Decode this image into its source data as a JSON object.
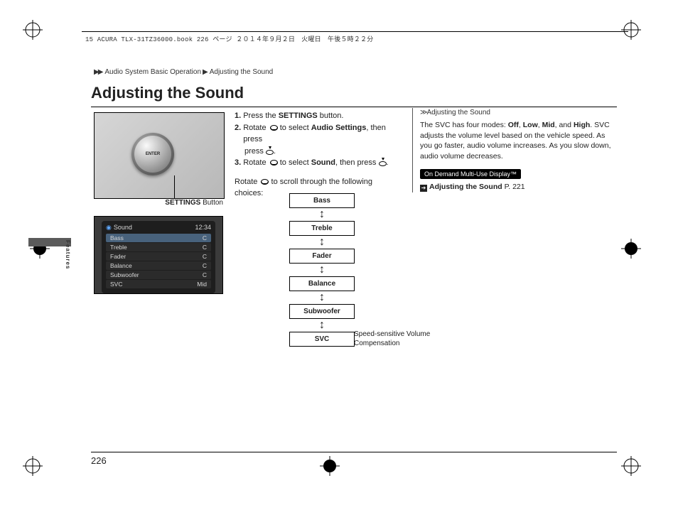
{
  "header_text": "15 ACURA TLX-31TZ36000.book  226 ページ  ２０１４年９月２日　火曜日　午後５時２２分",
  "breadcrumb": {
    "arrows": "▶▶",
    "part1": "Audio System Basic Operation",
    "part2": "Adjusting the Sound"
  },
  "title": "Adjusting the Sound",
  "side_label": "Features",
  "photo_label_strong": "SETTINGS",
  "photo_label_rest": " Button",
  "dial_text": "ENTER",
  "screen": {
    "title": "Sound",
    "clock": "12:34",
    "rows": [
      {
        "name": "Bass",
        "val": "C",
        "sel": true
      },
      {
        "name": "Treble",
        "val": "C",
        "sel": false
      },
      {
        "name": "Fader",
        "val": "C",
        "sel": false
      },
      {
        "name": "Balance",
        "val": "C",
        "sel": false
      },
      {
        "name": "Subwoofer",
        "val": "C",
        "sel": false
      },
      {
        "name": "SVC",
        "val": "Mid",
        "sel": false
      }
    ]
  },
  "steps": {
    "s1a": "Press the ",
    "s1b": "SETTINGS",
    "s1c": " button.",
    "s2a": "Rotate ",
    "s2b": " to select ",
    "s2c": "Audio Settings",
    "s2d": ", then press ",
    "s2e": ".",
    "s3a": "Rotate ",
    "s3b": " to select ",
    "s3c": "Sound",
    "s3d": ", then press ",
    "s3e": "."
  },
  "scroll_note_a": "Rotate ",
  "scroll_note_b": " to scroll through the following choices:",
  "flow_nodes": [
    "Bass",
    "Treble",
    "Fader",
    "Balance",
    "Subwoofer",
    "SVC"
  ],
  "svc_note": "Speed-sensitive Volume Compensation",
  "right": {
    "subhead": "Adjusting the Sound",
    "para_a": "The SVC has four modes: ",
    "m1": "Off",
    "m2": "Low",
    "m3": "Mid",
    "m4": "High",
    "para_b": ". SVC adjusts the volume level based on the vehicle speed. As you go faster, audio volume increases. As you slow down, audio volume decreases.",
    "chip": "On Demand Multi-Use Display™",
    "link_label": "Adjusting the Sound",
    "link_page": "P. 221"
  },
  "page_number": "226"
}
